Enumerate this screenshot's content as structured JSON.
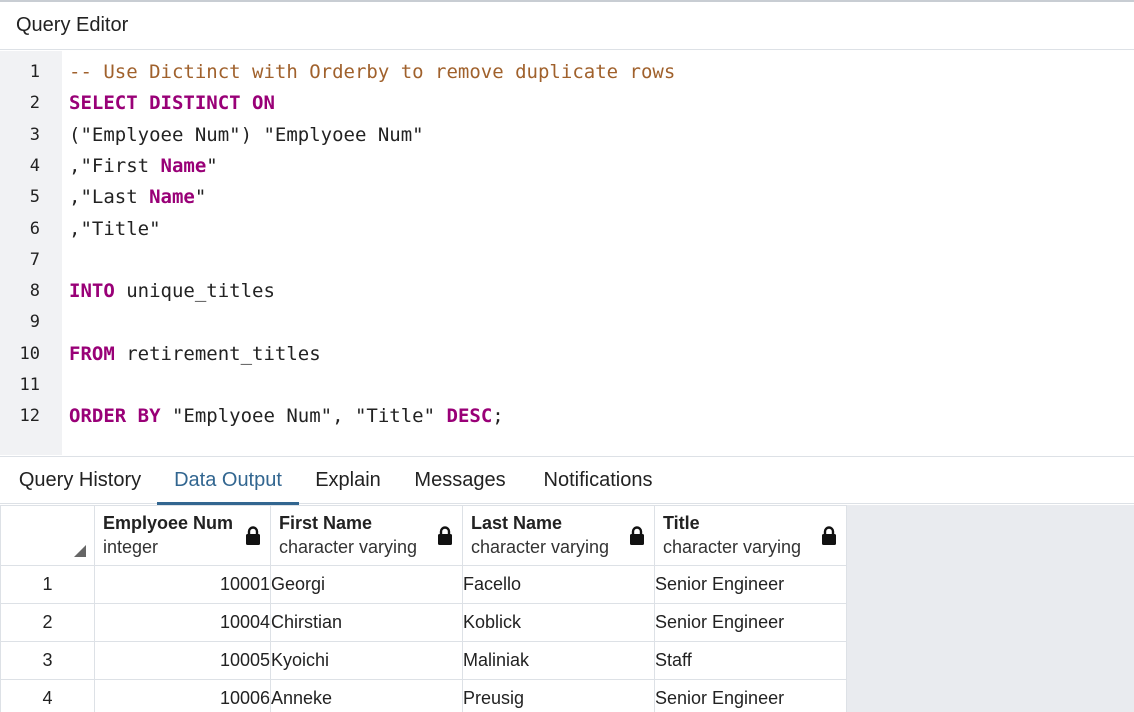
{
  "panel": {
    "title": "Query Editor"
  },
  "editor": {
    "line_numbers": [
      "1",
      "2",
      "3",
      "4",
      "5",
      "6",
      "7",
      "8",
      "9",
      "10",
      "11",
      "12"
    ],
    "lines": [
      [
        {
          "t": "cmt",
          "v": "-- Use Dictinct with Orderby to remove duplicate rows"
        }
      ],
      [
        {
          "t": "kw",
          "v": "SELECT DISTINCT ON"
        }
      ],
      [
        {
          "t": "txt",
          "v": "(\"Emplyoee Num\") \"Emplyoee Num\""
        }
      ],
      [
        {
          "t": "txt",
          "v": ",\"First "
        },
        {
          "t": "kw",
          "v": "Name"
        },
        {
          "t": "txt",
          "v": "\""
        }
      ],
      [
        {
          "t": "txt",
          "v": ",\"Last "
        },
        {
          "t": "kw",
          "v": "Name"
        },
        {
          "t": "txt",
          "v": "\""
        }
      ],
      [
        {
          "t": "txt",
          "v": ",\"Title\""
        }
      ],
      [],
      [
        {
          "t": "kw",
          "v": "INTO"
        },
        {
          "t": "txt",
          "v": " unique_titles"
        }
      ],
      [],
      [
        {
          "t": "kw",
          "v": "FROM"
        },
        {
          "t": "txt",
          "v": " retirement_titles"
        }
      ],
      [],
      [
        {
          "t": "kw",
          "v": "ORDER BY"
        },
        {
          "t": "txt",
          "v": " \"Emplyoee Num\", \"Title\" "
        },
        {
          "t": "kw",
          "v": "DESC"
        },
        {
          "t": "txt",
          "v": ";"
        }
      ]
    ]
  },
  "tabs": [
    "Query History",
    "Data Output",
    "Explain",
    "Messages",
    "Notifications"
  ],
  "active_tab": "Data Output",
  "grid": {
    "columns": [
      {
        "name": "Emplyoee Num",
        "type": "integer"
      },
      {
        "name": "First Name",
        "type": "character varying"
      },
      {
        "name": "Last Name",
        "type": "character varying"
      },
      {
        "name": "Title",
        "type": "character varying"
      }
    ],
    "rows": [
      {
        "n": "1",
        "cells": [
          "10001",
          "Georgi",
          "Facello",
          "Senior Engineer"
        ]
      },
      {
        "n": "2",
        "cells": [
          "10004",
          "Chirstian",
          "Koblick",
          "Senior Engineer"
        ]
      },
      {
        "n": "3",
        "cells": [
          "10005",
          "Kyoichi",
          "Maliniak",
          "Staff"
        ]
      },
      {
        "n": "4",
        "cells": [
          "10006",
          "Anneke",
          "Preusig",
          "Senior Engineer"
        ]
      }
    ]
  },
  "icons": {
    "lock": "lock-icon",
    "sort_corner": "corner-triangle-icon"
  },
  "colors": {
    "keyword": "#990077",
    "comment": "#a0612c",
    "active_tab": "#326690"
  }
}
